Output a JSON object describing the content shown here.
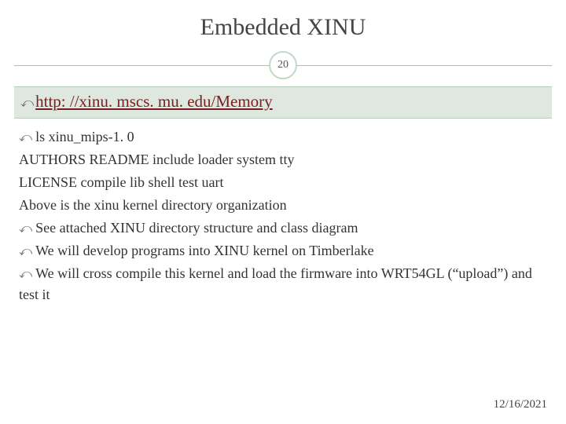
{
  "title": "Embedded XINU",
  "page_number": "20",
  "link": {
    "text": "http: //xinu. mscs. mu. edu/Memory"
  },
  "body": {
    "b1": "ls xinu_mips-1. 0",
    "l2": "AUTHORS README  include loader  system  tty",
    "l3": "LICENSE compile lib    shell   test   uart",
    "l4": "Above is the xinu kernel directory organization",
    "b5": "See attached XINU directory structure and class diagram",
    "b6": "We will develop programs into XINU kernel on Timberlake",
    "b7": "We will cross compile this kernel and load the firmware into WRT54GL (“upload”) and test it"
  },
  "date": "12/16/2021"
}
